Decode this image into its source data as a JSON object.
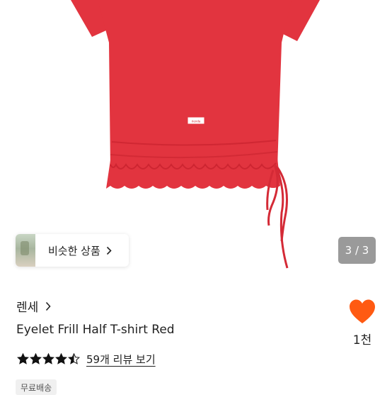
{
  "product": {
    "image_color": "#e2343f",
    "tag_text": "rienda"
  },
  "similar": {
    "label": "비슷한 상품"
  },
  "pager": {
    "text": "3 / 3"
  },
  "brand": {
    "name": "렌세"
  },
  "title": "Eyelet Frill Half T-shirt Red",
  "rating": {
    "value": 4.5,
    "max": 5,
    "review_link": "59개 리뷰 보기"
  },
  "like": {
    "count": "1천",
    "color": "#ff5a12"
  },
  "badge": {
    "shipping": "무료배송"
  }
}
